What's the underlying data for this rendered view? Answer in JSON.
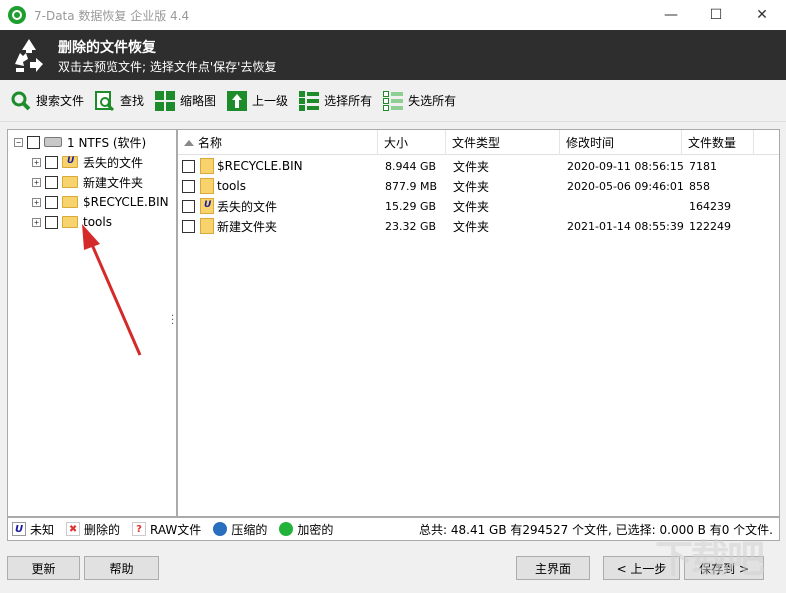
{
  "window": {
    "title": "7-Data 数据恢复 企业版 4.4",
    "controls": {
      "minimize": "—",
      "maximize": "☐",
      "close": "✕"
    }
  },
  "header": {
    "title": "删除的文件恢复",
    "subtitle": "双击去预览文件; 选择文件点'保存'去恢复"
  },
  "toolbar": {
    "items": [
      {
        "label": "搜索文件",
        "icon": "search-icon"
      },
      {
        "label": "查找",
        "icon": "find-icon"
      },
      {
        "label": "缩略图",
        "icon": "thumbnail-icon"
      },
      {
        "label": "上一级",
        "icon": "up-level-icon"
      },
      {
        "label": "选择所有",
        "icon": "select-all-icon"
      },
      {
        "label": "失选所有",
        "icon": "deselect-all-icon"
      }
    ]
  },
  "tree": {
    "root": {
      "label": "1 NTFS (软件)",
      "expander": "−"
    },
    "children": [
      {
        "label": "丢失的文件",
        "expander": "+",
        "unknown": true
      },
      {
        "label": "新建文件夹",
        "expander": "+",
        "unknown": false
      },
      {
        "label": "$RECYCLE.BIN",
        "expander": "+",
        "unknown": false
      },
      {
        "label": "tools",
        "expander": "+",
        "unknown": false
      }
    ]
  },
  "file_list": {
    "columns": [
      "名称",
      "大小",
      "文件类型",
      "修改时间",
      "文件数量"
    ],
    "rows": [
      {
        "name": "$RECYCLE.BIN",
        "size": "8.944 GB",
        "type": "文件夹",
        "modified": "2020-09-11 08:56:15",
        "count": "7181",
        "unknown": false
      },
      {
        "name": "tools",
        "size": "877.9 MB",
        "type": "文件夹",
        "modified": "2020-05-06 09:46:01",
        "count": "858",
        "unknown": false
      },
      {
        "name": "丢失的文件",
        "size": "15.29 GB",
        "type": "文件夹",
        "modified": "",
        "count": "164239",
        "unknown": true
      },
      {
        "name": "新建文件夹",
        "size": "23.32 GB",
        "type": "文件夹",
        "modified": "2021-01-14 08:55:39",
        "count": "122249",
        "unknown": false
      }
    ]
  },
  "legend": {
    "unknown": "未知",
    "deleted": "删除的",
    "raw": "RAW文件",
    "compressed": "压缩的",
    "encrypted": "加密的",
    "summary": "总共: 48.41 GB 有294527 个文件, 已选择: 0.000 B 有0 个文件."
  },
  "buttons": {
    "refresh": "更新",
    "help": "帮助",
    "home": "主界面",
    "back": "< 上一步",
    "save_to": "保存到 >"
  },
  "colors": {
    "header_bg": "#2e2e2e",
    "accent_green": "#1e9e2e",
    "folder": "#f7d36e",
    "annotation_arrow": "#d42a2a"
  },
  "watermark": "下载吧"
}
